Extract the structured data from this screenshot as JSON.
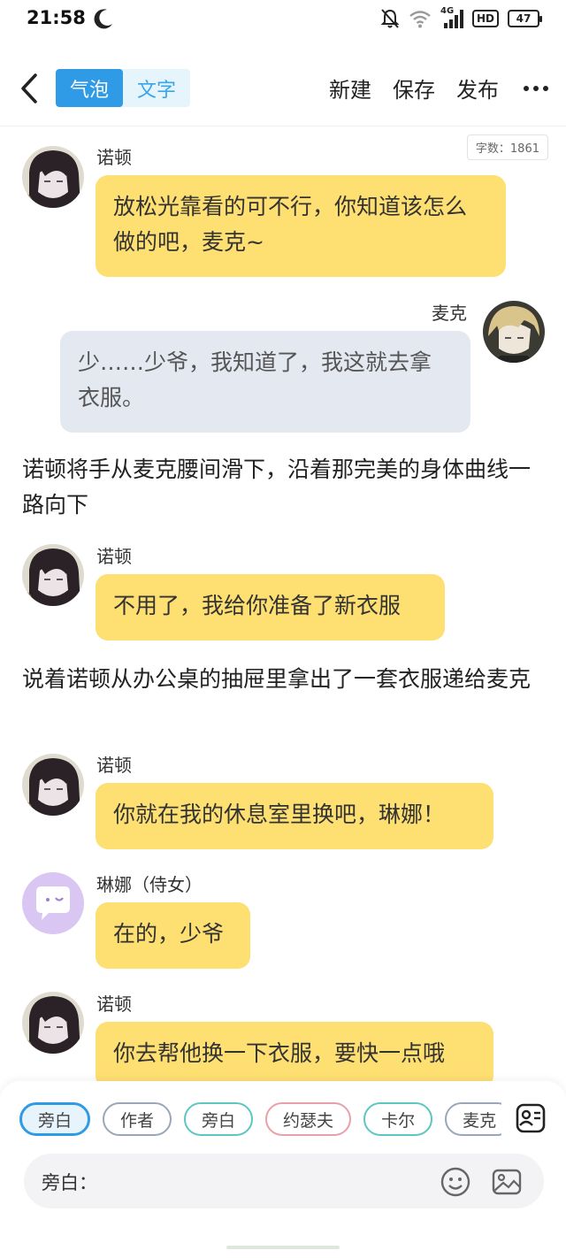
{
  "status_bar": {
    "time": "21:58",
    "network": "4G",
    "hd": "HD",
    "battery": "47"
  },
  "header": {
    "back_icon": "chevron-left-icon",
    "mode_tabs": [
      {
        "label": "气泡",
        "active": true
      },
      {
        "label": "文字",
        "active": false
      }
    ],
    "actions": [
      "新建",
      "保存",
      "发布"
    ],
    "more_icon": "more-horizontal-icon"
  },
  "word_count": "字数：1861",
  "messages": [
    {
      "type": "bubble",
      "speaker": "诺顿",
      "side": "left",
      "color": "#fedf72",
      "text": "放松光靠看的可不行，你知道该怎么做的吧，麦克~"
    },
    {
      "type": "bubble",
      "speaker": "麦克",
      "side": "right",
      "color": "#e4e8f0",
      "text": "少……少爷，我知道了，我这就去拿衣服。"
    },
    {
      "type": "narration",
      "text": "诺顿将手从麦克腰间滑下，沿着那完美的身体曲线一路向下"
    },
    {
      "type": "bubble",
      "speaker": "诺顿",
      "side": "left",
      "color": "#fedf72",
      "text": "不用了，我给你准备了新衣服"
    },
    {
      "type": "narration",
      "text": "说着诺顿从办公桌的抽屉里拿出了一套衣服递给麦克"
    },
    {
      "type": "bubble",
      "speaker": "诺顿",
      "side": "left",
      "color": "#fedf72",
      "text": "你就在我的休息室里换吧，琳娜！"
    },
    {
      "type": "bubble",
      "speaker": "琳娜（侍女）",
      "side": "left",
      "color": "#fedf72",
      "text": "在的，少爷"
    },
    {
      "type": "bubble",
      "speaker": "诺顿",
      "side": "left",
      "color": "#fedf72",
      "text": "你去帮他换一下衣服，要快一点哦"
    }
  ],
  "role_chips": [
    {
      "label": "旁白",
      "border": "#2f9ae6",
      "bg": "#e8f4fc",
      "selected": true
    },
    {
      "label": "作者",
      "border": "#9aa7b8",
      "bg": "#ffffff",
      "selected": false
    },
    {
      "label": "旁白",
      "border": "#5cc7c0",
      "bg": "#ffffff",
      "selected": false
    },
    {
      "label": "约瑟夫",
      "border": "#e9a0a8",
      "bg": "#ffffff",
      "selected": false
    },
    {
      "label": "卡尔",
      "border": "#5cc7c0",
      "bg": "#ffffff",
      "selected": false
    },
    {
      "label": "麦克",
      "border": "#9aa7b8",
      "bg": "#ffffff",
      "selected": false
    }
  ],
  "input": {
    "label": "旁白：",
    "emoji_icon": "smiley-icon",
    "image_icon": "image-icon",
    "contacts_icon": "contacts-icon"
  }
}
